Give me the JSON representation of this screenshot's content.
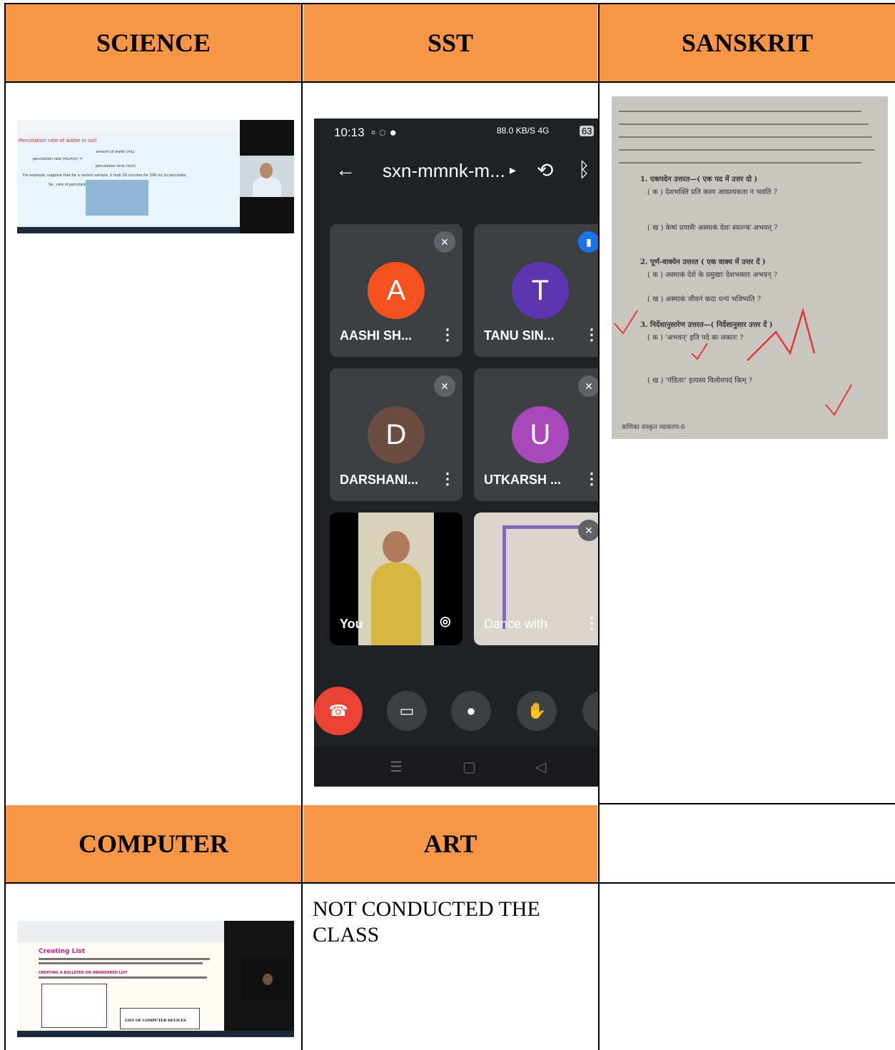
{
  "headers": {
    "science": "SCIENCE",
    "sst": "SST",
    "sanskrit": "SANSKRIT",
    "computer": "COMPUTER",
    "art": "ART"
  },
  "art_note": "NOT CONDUCTED THE CLASS",
  "science_slide": {
    "title": "Percolation rate of water in soil",
    "formula_top": "amount of water (mL)",
    "formula_left": "percolation rate (mL/min) =",
    "formula_bottom": "percolation time (min)",
    "example": "For example, suppose that for a certain sample, it took 20 minutes for 200 mL to percolate.",
    "result": "So , rate of percolation = 200 mL / 20 min = 10mL/min"
  },
  "meet": {
    "time": "10:13",
    "status_right": "88.0 KB/S 4G",
    "battery": "63",
    "meeting_code": "sxn-mmnk-m...",
    "participants": [
      {
        "initial": "A",
        "name": "AASHI SH...",
        "color": "#f4511e"
      },
      {
        "initial": "T",
        "name": "TANU SIN...",
        "color": "#5e35b1"
      },
      {
        "initial": "D",
        "name": "DARSHANI...",
        "color": "#6d4c41"
      },
      {
        "initial": "U",
        "name": "UTKARSH ...",
        "color": "#ab47bc"
      }
    ],
    "self_label": "You",
    "other_label": "Dance with"
  },
  "sanskrit_doc": {
    "q1": "1. एकपदेन उत्तरत—( एक पद में उत्तर दो )",
    "q1a": "( क ) देशभक्तिं प्रति कस्य आवश्यकता न भवति ?",
    "q1b": "( ख ) केषां प्रयासैः अस्माकं देशः स्वतन्त्रः अभवत् ?",
    "q2": "2. पूर्ण-वाक्येन उत्तरत ( एक वाक्य में उत्तर दें )",
    "q2a": "( क ) अस्माकं देशे के प्रमुखाः देशभक्ताः अभवन् ?",
    "q2b": "( ख ) अस्माकं जीवनं कदा धन्यं भविष्यति ?",
    "q3": "3. निर्देशानुसारेण उत्तरत—( निर्देशानुसार उत्तर दें )",
    "q3a": "( क ) 'अभवन्' इति पदे कः लकारः ?",
    "q3b": "( ख ) 'पंडिताः' इत्यस्य विलोमपदं किम् ?",
    "footer": "कणिका संस्कृत व्याकरण-6"
  },
  "computer_doc": {
    "heading": "Creating List",
    "subheading": "CREATING A BULLETED OR UNORDERED LIST",
    "box2": "LIST OF COMPUTER DEVICES"
  }
}
